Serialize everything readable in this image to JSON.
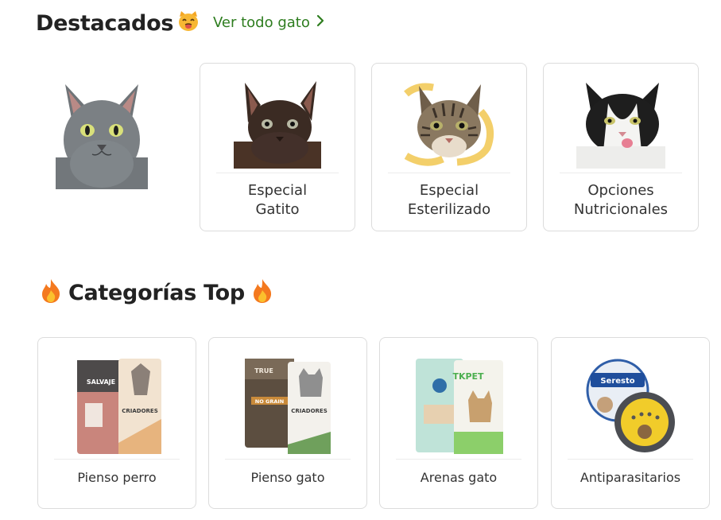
{
  "featured": {
    "title": "Destacados",
    "see_all_label": "Ver todo gato",
    "cards": [
      {
        "line1": "Especial",
        "line2": "Gatito"
      },
      {
        "line1": "Especial",
        "line2": "Esterilizado"
      },
      {
        "line1": "Opciones",
        "line2": "Nutricionales"
      }
    ]
  },
  "top_categories": {
    "title": "Categorías Top",
    "cards": [
      {
        "label": "Pienso perro"
      },
      {
        "label": "Pienso gato"
      },
      {
        "label": "Arenas gato"
      },
      {
        "label": "Antiparasitarios"
      }
    ]
  },
  "package_text": {
    "salvaje": "SALVAJE",
    "criadores": "CRIADORES",
    "true_origins": "TRUE",
    "no_grain": "NO GRAIN",
    "tkpet": "TKPET",
    "seresto": "Seresto"
  },
  "colors": {
    "link_green": "#2e7d1f",
    "card_border": "#dcdcdc",
    "heading_text": "#222222"
  },
  "icons": [
    "cat-emoji-icon",
    "fire-emoji-icon",
    "chevron-right-icon"
  ]
}
